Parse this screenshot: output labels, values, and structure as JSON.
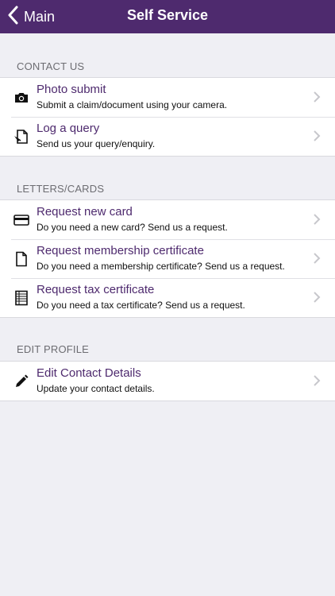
{
  "navbar": {
    "back_label": "Main",
    "title": "Self Service",
    "background": "#4e2a6e"
  },
  "sections": [
    {
      "header": "CONTACT US",
      "items": [
        {
          "icon": "camera-icon",
          "title": "Photo submit",
          "subtitle": "Submit a claim/document using your camera."
        },
        {
          "icon": "query-document-icon",
          "title": "Log a query",
          "subtitle": "Send us your query/enquiry."
        }
      ]
    },
    {
      "header": "LETTERS/CARDS",
      "items": [
        {
          "icon": "card-icon",
          "title": "Request new card",
          "subtitle": "Do you need a new card? Send us a request."
        },
        {
          "icon": "document-icon",
          "title": "Request membership certificate",
          "subtitle": "Do you need a membership certificate? Send us a request."
        },
        {
          "icon": "spreadsheet-icon",
          "title": "Request tax certificate",
          "subtitle": "Do you need a tax certificate? Send us a request."
        }
      ]
    },
    {
      "header": "EDIT PROFILE",
      "items": [
        {
          "icon": "pencil-icon",
          "title": "Edit Contact Details",
          "subtitle": "Update your contact details."
        }
      ]
    }
  ]
}
